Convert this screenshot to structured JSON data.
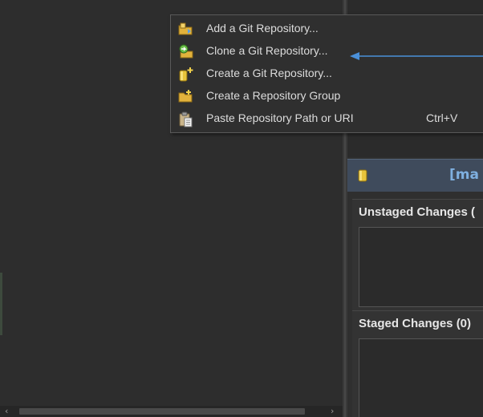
{
  "context_menu": {
    "items": [
      {
        "label": "Add a Git Repository...",
        "icon": "add-repository-icon",
        "shortcut": ""
      },
      {
        "label": "Clone a Git Repository...",
        "icon": "clone-repository-icon",
        "shortcut": ""
      },
      {
        "label": "Create a Git Repository...",
        "icon": "create-repository-icon",
        "shortcut": ""
      },
      {
        "label": "Create a Repository Group",
        "icon": "create-group-icon",
        "shortcut": ""
      },
      {
        "label": "Paste Repository Path or URI",
        "icon": "paste-icon",
        "shortcut": "Ctrl+V"
      }
    ]
  },
  "staging": {
    "branch_label": "[ma",
    "unstaged_title": "Unstaged Changes (",
    "staged_title": "Staged Changes (0)"
  },
  "colors": {
    "background": "#2b2b2b",
    "menu_background": "#2f2f2f",
    "menu_text": "#dcdcdc",
    "repo_header": "#3f4b5c",
    "branch_text": "#7fb0e0",
    "annotation_arrow": "#4a90d9"
  }
}
